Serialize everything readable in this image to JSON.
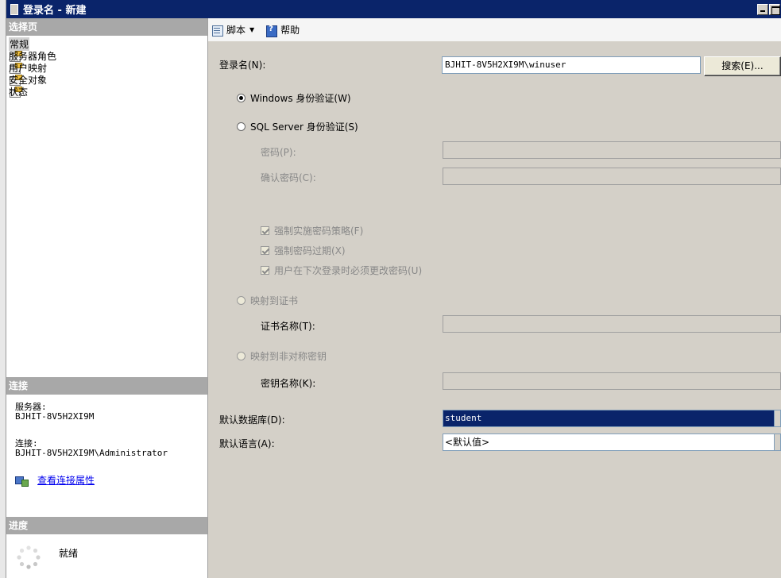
{
  "window": {
    "title": "登录名 - 新建"
  },
  "left": {
    "select_page_header": "选择页",
    "pages": [
      {
        "label": "常规"
      },
      {
        "label": "服务器角色"
      },
      {
        "label": "用户映射"
      },
      {
        "label": "安全对象"
      },
      {
        "label": "状态"
      }
    ],
    "connection_header": "连接",
    "server_label": "服务器:",
    "server_value": "BJHIT-8V5H2XI9M",
    "connection_label": "连接:",
    "connection_value": "BJHIT-8V5H2XI9M\\Administrator",
    "view_props_link": "查看连接属性",
    "progress_header": "进度",
    "progress_status": "就绪"
  },
  "toolbar": {
    "script_label": "脚本",
    "help_label": "帮助"
  },
  "form": {
    "login_name_label": "登录名(N):",
    "login_name_value": "BJHIT-8V5H2XI9M\\winuser",
    "search_button": "搜索(E)...",
    "windows_auth": "Windows 身份验证(W)",
    "sql_auth": "SQL Server 身份验证(S)",
    "password_label": "密码(P):",
    "confirm_password_label": "确认密码(C):",
    "enforce_policy": "强制实施密码策略(F)",
    "enforce_expiration": "强制密码过期(X)",
    "must_change": "用户在下次登录时必须更改密码(U)",
    "map_cert": "映射到证书",
    "cert_name_label": "证书名称(T):",
    "map_asym_key": "映射到非对称密钥",
    "key_name_label": "密钥名称(K):",
    "default_db_label": "默认数据库(D):",
    "default_db_value": "student",
    "default_lang_label": "默认语言(A):",
    "default_lang_value": "<默认值>"
  },
  "state": {
    "selected_page": "常规",
    "auth_mode": "Windows 身份验证",
    "enforce_policy_checked": true,
    "enforce_expiration_checked": true,
    "must_change_checked": true
  }
}
